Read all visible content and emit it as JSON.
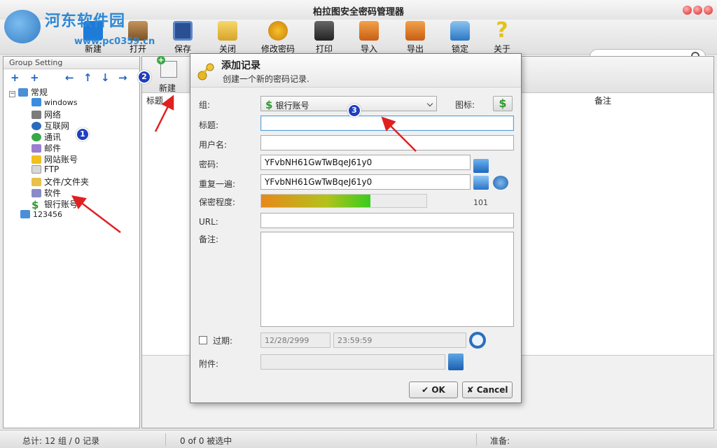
{
  "window": {
    "title": "柏拉图安全密码管理器"
  },
  "watermark": {
    "text": "河东软件园",
    "url": "www.pc0359.cn"
  },
  "toolbar": {
    "items": [
      {
        "label": "新建",
        "icon": "new-icon"
      },
      {
        "label": "打开",
        "icon": "open-icon"
      },
      {
        "label": "保存",
        "icon": "save-icon"
      },
      {
        "label": "关闭",
        "icon": "close-icon"
      },
      {
        "label": "修改密码",
        "icon": "key-icon"
      },
      {
        "label": "打印",
        "icon": "print-icon"
      },
      {
        "label": "导入",
        "icon": "import-icon"
      },
      {
        "label": "导出",
        "icon": "export-icon"
      },
      {
        "label": "锁定",
        "icon": "lock-icon"
      },
      {
        "label": "关于",
        "icon": "help-icon"
      }
    ]
  },
  "sidebar": {
    "title": "Group Setting",
    "root": "常规",
    "children": [
      "windows",
      "网络",
      "互联网",
      "通讯",
      "邮件",
      "网站账号",
      "FTP",
      "文件/文件夹",
      "软件",
      "银行账号"
    ],
    "other_group": "123456"
  },
  "records_panel": {
    "new_label": "新建",
    "columns": [
      "标题",
      "备注"
    ]
  },
  "dialog": {
    "title": "添加记录",
    "subtitle": "创建一个新的密码记录.",
    "group_label": "组:",
    "group_value": "银行账号",
    "icon_label": "图标:",
    "title_label": "标题:",
    "title_value": "",
    "username_label": "用户名:",
    "username_value": "",
    "password_label": "密码:",
    "password_value": "YFvbNH61GwTwBqeJ61y0",
    "repeat_label": "重复一遍:",
    "repeat_value": "YFvbNH61GwTwBqeJ61y0",
    "strength_label": "保密程度:",
    "strength_value": 101,
    "strength_fraction": 0.66,
    "url_label": "URL:",
    "url_value": "",
    "notes_label": "备注:",
    "notes_value": "",
    "expiry_label": "过期:",
    "expiry_checked": false,
    "expiry_date": "12/28/2999",
    "expiry_time": "23:59:59",
    "attachment_label": "附件:",
    "attachment_value": "",
    "ok_label": "OK",
    "cancel_label": "Cancel"
  },
  "status": {
    "total": "总计: 12 组 / 0 记录",
    "selected": "0 of 0 被选中",
    "ready": "准备:"
  },
  "annotations": [
    "1",
    "2",
    "3"
  ],
  "colors": {
    "accent": "#1e66c2",
    "badge": "#1f3fbf",
    "arrow": "#e02020",
    "money": "#2f9a2f"
  }
}
